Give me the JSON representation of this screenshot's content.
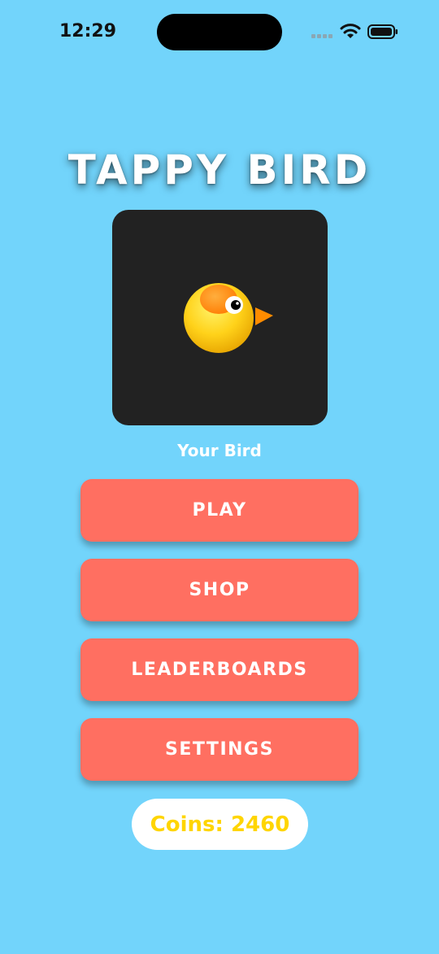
{
  "status_bar": {
    "time": "12:29",
    "icons": [
      "cellular-signal-icon",
      "wifi-icon",
      "battery-icon"
    ]
  },
  "game": {
    "title": "TAPPY BIRD",
    "bird_label": "Your Bird",
    "bird_icon": "bird-icon"
  },
  "menu": {
    "play": "PLAY",
    "shop": "SHOP",
    "leaderboards": "LEADERBOARDS",
    "settings": "SETTINGS"
  },
  "coins": {
    "text": "Coins: 2460"
  },
  "colors": {
    "background": "#72d4fb",
    "button": "#ff6f61",
    "card": "#222222",
    "coins_text": "#ffd500"
  }
}
